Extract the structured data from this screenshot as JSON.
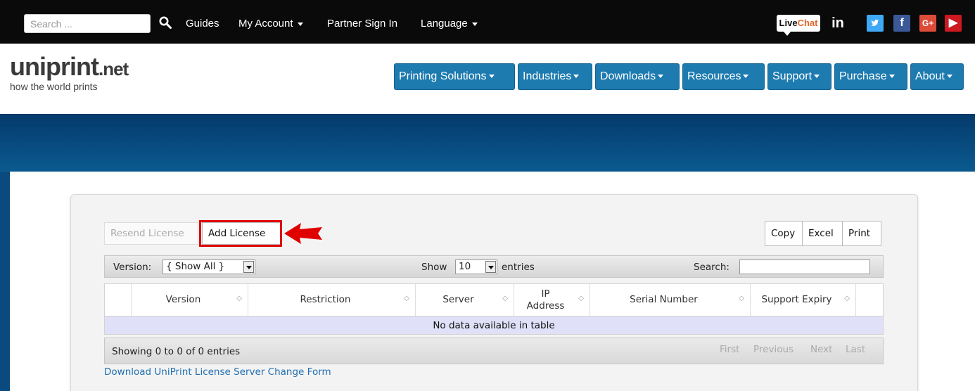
{
  "topbar": {
    "search_placeholder": "Search ...",
    "links": [
      "Guides",
      "My Account",
      "Partner Sign In",
      "Language"
    ],
    "livechat": {
      "live": "Live",
      "chat": "Chat"
    },
    "social": [
      "in",
      "t",
      "f",
      "G+",
      "▶"
    ]
  },
  "logo": {
    "word_main": "uniprint",
    "word_suffix": ".net",
    "tagline": "how the world prints"
  },
  "menu": [
    "Printing Solutions",
    "Industries",
    "Downloads",
    "Resources",
    "Support",
    "Purchase",
    "About"
  ],
  "panel": {
    "resend_label": "Resend License",
    "add_label": "Add License",
    "copy_label": "Copy",
    "excel_label": "Excel",
    "print_label": "Print",
    "version_label": "Version:",
    "version_value": "{ Show All }",
    "show_label": "Show",
    "show_value": "10",
    "entries_label": "entries",
    "search_label": "Search:",
    "columns": [
      "Version",
      "Restriction",
      "Server",
      "IP Address",
      "Serial Number",
      "Support Expiry"
    ],
    "empty_text": "No data available in table",
    "showing_text": "Showing 0 to 0 of 0 entries",
    "pager": [
      "First",
      "Previous",
      "Next",
      "Last"
    ],
    "download_link": "Download UniPrint License Server Change Form"
  },
  "colors": {
    "accent": "#1d7bb0",
    "highlight": "#e00000",
    "empty_row": "#e0e0f8"
  }
}
